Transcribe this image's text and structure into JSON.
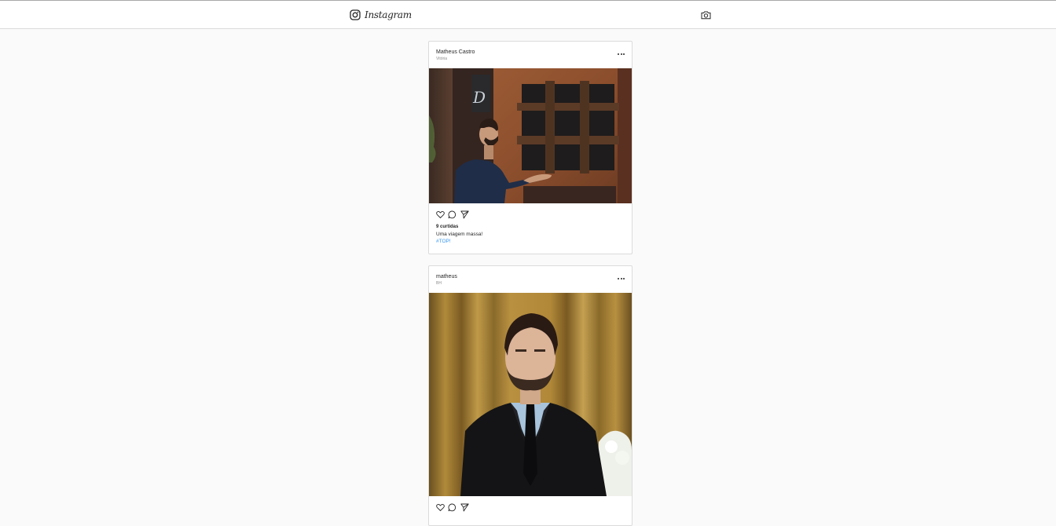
{
  "app": {
    "title": "Instagram",
    "icons": {
      "logo": "instagram-logo-icon",
      "camera": "camera-icon"
    }
  },
  "colors": {
    "background": "#fafafa",
    "card": "#ffffff",
    "border": "#dbdbdb",
    "text": "#262626",
    "muted": "#8e8e8e",
    "link": "#3897f0"
  },
  "posts": [
    {
      "username": "Matheus Castro",
      "location": "Vitória",
      "image": "man-in-navy-tshirt-gesturing-at-wooden-door-photo",
      "likes": "9 curtidas",
      "caption": "Uma viagem massa!",
      "hashtag": "#TOP!"
    },
    {
      "username": "matheus",
      "location": "BH",
      "image": "man-in-black-suit-and-tie-portrait-photo"
    }
  ]
}
